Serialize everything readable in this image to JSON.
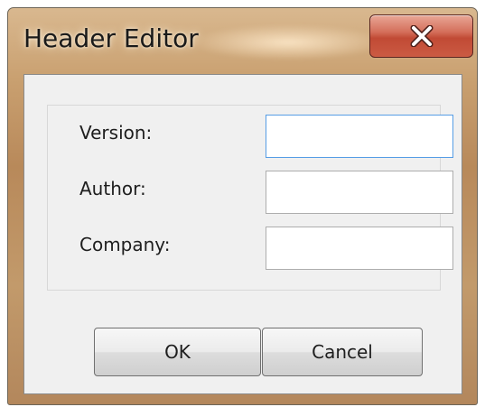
{
  "window": {
    "title": "Header Editor",
    "close_icon": "close-x-icon"
  },
  "form": {
    "fields": [
      {
        "label": "Version:",
        "value": ""
      },
      {
        "label": "Author:",
        "value": ""
      },
      {
        "label": "Company:",
        "value": ""
      }
    ]
  },
  "buttons": {
    "ok_label": "OK",
    "cancel_label": "Cancel"
  },
  "colors": {
    "close_button": "#c7513b",
    "focus_border": "#569de5",
    "dialog_face": "#f0f0f0"
  }
}
